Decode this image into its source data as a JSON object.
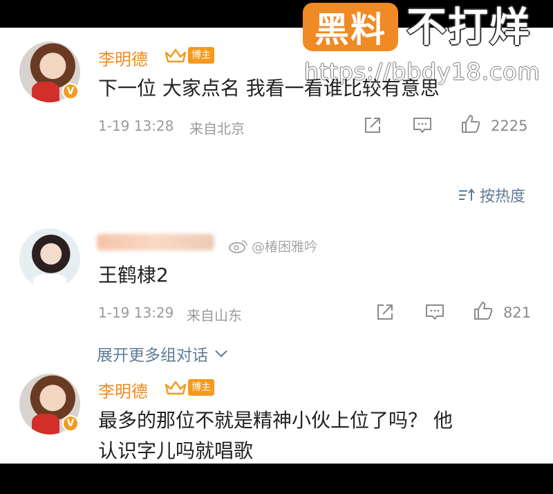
{
  "watermark": {
    "logo_text": "黑料",
    "tagline": "不打烊",
    "url": "https://bbdy18.com"
  },
  "comments": [
    {
      "username": "李明德",
      "role_badge": "博主",
      "badge_mark": "V",
      "text": "下一位 大家点名 我看一看谁比较有意思",
      "time": "1-19 13:28",
      "location": "来自北京",
      "likes": "2225"
    },
    {
      "username": "",
      "source_tag": "@椿困雅吟",
      "text": "王鹤棣2",
      "time": "1-19 13:29",
      "location": "来自山东",
      "likes": "821"
    },
    {
      "username": "李明德",
      "role_badge": "博主",
      "badge_mark": "V",
      "text_line1": "最多的那位不就是精神小伙上位了吗？ 他",
      "text_line2": "认识字儿吗就唱歌"
    }
  ],
  "sort": {
    "label": "按热度"
  },
  "expand": {
    "label": "展开更多组对话"
  },
  "colors": {
    "accent_orange": "#f08a24",
    "badge_orange": "#f59a1e",
    "link_blue_gray": "#5e7a97",
    "meta_gray": "#9a9a9a"
  },
  "icons": [
    "share-icon",
    "comment-icon",
    "thumbs-up-icon",
    "sort-icon",
    "chevron-down-icon",
    "crown-icon",
    "weibo-icon"
  ]
}
